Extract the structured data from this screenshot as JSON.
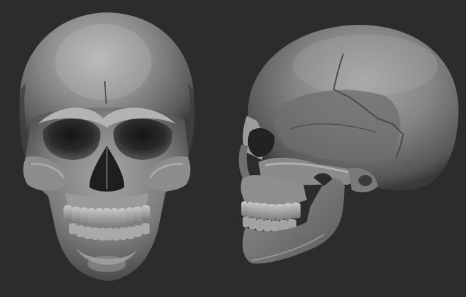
{
  "scene": {
    "background_color": "#2c2c2c",
    "subjects": [
      {
        "name": "skull-front-view",
        "material_color": "#8a8a8a"
      },
      {
        "name": "skull-side-view",
        "material_color": "#8a8a8a"
      }
    ]
  }
}
